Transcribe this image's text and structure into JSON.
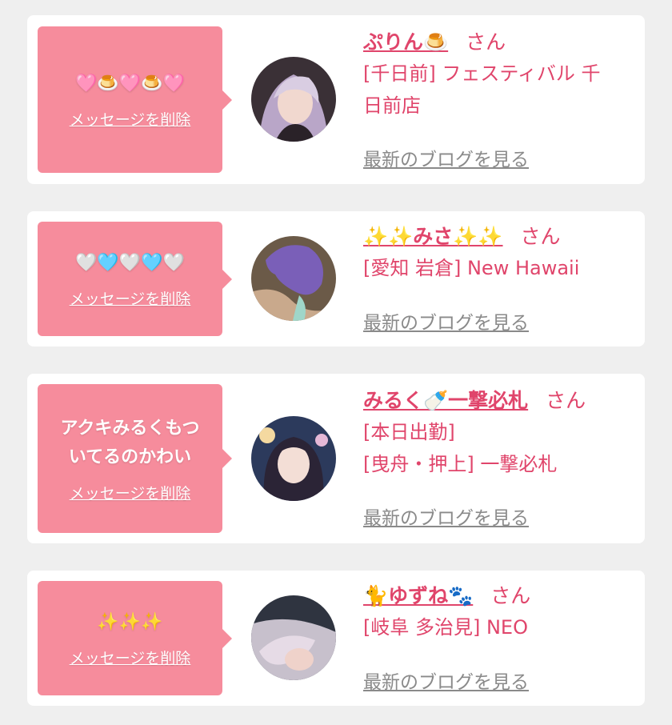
{
  "cards": [
    {
      "message": "🩷🍮🩷🍮🩷",
      "delete_label": "メッセージを削除",
      "name": "ぷりん🍮",
      "honorific": "さん",
      "shop_lines": [
        "[千日前] フェスティバル 千",
        "日前店"
      ],
      "blog_label": "最新のブログを見る"
    },
    {
      "message": "🤍🩵🤍🩵🤍",
      "delete_label": "メッセージを削除",
      "name": "✨✨みさ✨✨",
      "honorific": "さん",
      "shop_lines": [
        "[愛知 岩倉] New Hawaii"
      ],
      "blog_label": "最新のブログを見る"
    },
    {
      "message_lines": [
        "アクキみるくもつ",
        "いてるのかわい"
      ],
      "delete_label": "メッセージを削除",
      "name": "みるく🍼一撃必札",
      "honorific": "さん",
      "shop_lines": [
        "[本日出勤]",
        "[曳舟・押上] 一撃必札"
      ],
      "blog_label": "最新のブログを見る"
    },
    {
      "message": "✨✨✨",
      "delete_label": "メッセージを削除",
      "name": "🐈ゆずね🐾",
      "honorific": "さん",
      "shop_lines": [
        "[岐阜 多治見] NEO"
      ],
      "blog_label": "最新のブログを見る"
    }
  ],
  "colors": {
    "background": "#efefef",
    "bubble": "#f68c9c",
    "accent_text": "#e0456b",
    "blog_link": "#8a8a8a"
  }
}
